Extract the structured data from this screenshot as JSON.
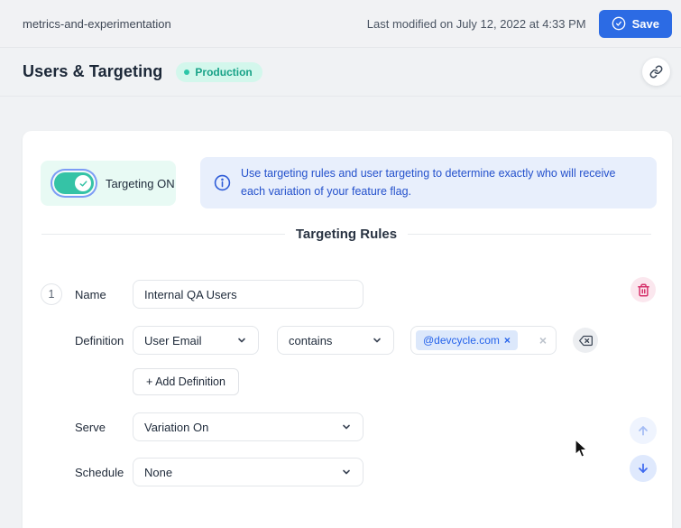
{
  "topbar": {
    "breadcrumb": "metrics-and-experimentation",
    "last_modified": "Last modified on July 12, 2022 at 4:33 PM",
    "save_label": "Save"
  },
  "header": {
    "title": "Users & Targeting",
    "environment_badge": "Production"
  },
  "panel": {
    "targeting_toggle_label": "Targeting ON",
    "info_text": "Use targeting rules and user targeting to determine exactly who will receive each variation of your feature flag.",
    "section_title": "Targeting Rules"
  },
  "rule": {
    "number": "1",
    "name_label": "Name",
    "name_value": "Internal QA Users",
    "definition_label": "Definition",
    "property_value": "User Email",
    "comparator_value": "contains",
    "chip_value": "@devcycle.com",
    "chip_close_glyph": "×",
    "clear_glyph": "×",
    "add_definition_label": "+ Add Definition",
    "serve_label": "Serve",
    "serve_value": "Variation On",
    "schedule_label": "Schedule",
    "schedule_value": "None"
  },
  "colors": {
    "accent_blue": "#2c6be4",
    "info_blue": "#2451cc",
    "toggle_teal": "#35c3a6",
    "badge_teal": "#17a287",
    "danger_pink": "#d6336c",
    "chip_blue": "#2563eb",
    "page_bg": "#f0f2f4"
  }
}
